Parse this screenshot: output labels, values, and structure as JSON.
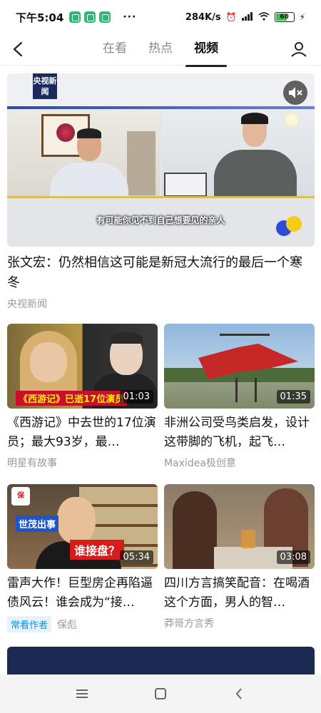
{
  "status_bar": {
    "time": "下午5:04",
    "more": "···",
    "network_speed": "284K/s",
    "signal_label": "HD",
    "battery_level": "60"
  },
  "nav": {
    "tabs": [
      {
        "label": "在看",
        "active": false
      },
      {
        "label": "热点",
        "active": false
      },
      {
        "label": "视频",
        "active": true
      }
    ]
  },
  "hero": {
    "logo_text": "央视新闻",
    "subtitle": "有可能你见不到自己想要见的亲人",
    "title": "张文宏：仍然相信这可能是新冠大流行的最后一个寒冬",
    "source": "央视新闻"
  },
  "videos": [
    {
      "overlay": "《西游记》已逝17位演员",
      "duration": "01:03",
      "title": "《西游记》中去世的17位演员；最大93岁，最…",
      "source": "明星有故事",
      "tag": ""
    },
    {
      "overlay": "",
      "duration": "01:35",
      "title": "非洲公司受鸟类启发，设计这带脚的飞机，起飞…",
      "source": "Maxidea极创意",
      "tag": ""
    },
    {
      "overlay_blue": "世茂出事",
      "overlay_red": "谁接盘？",
      "duration": "05:34",
      "title": "雷声大作！巨型房企再陷逼债风云！谁会成为“接…",
      "source": "保彪",
      "tag": "常看作者"
    },
    {
      "overlay": "",
      "duration": "03:08",
      "title": "四川方言搞笑配音：在喝酒这个方面，男人的智…",
      "source": "莽哥方言秀",
      "tag": ""
    }
  ],
  "colors": {
    "accent_blue": "#1a88e0",
    "tab_active": "#111111",
    "tab_inactive": "#888888",
    "meta_gray": "#999999"
  }
}
